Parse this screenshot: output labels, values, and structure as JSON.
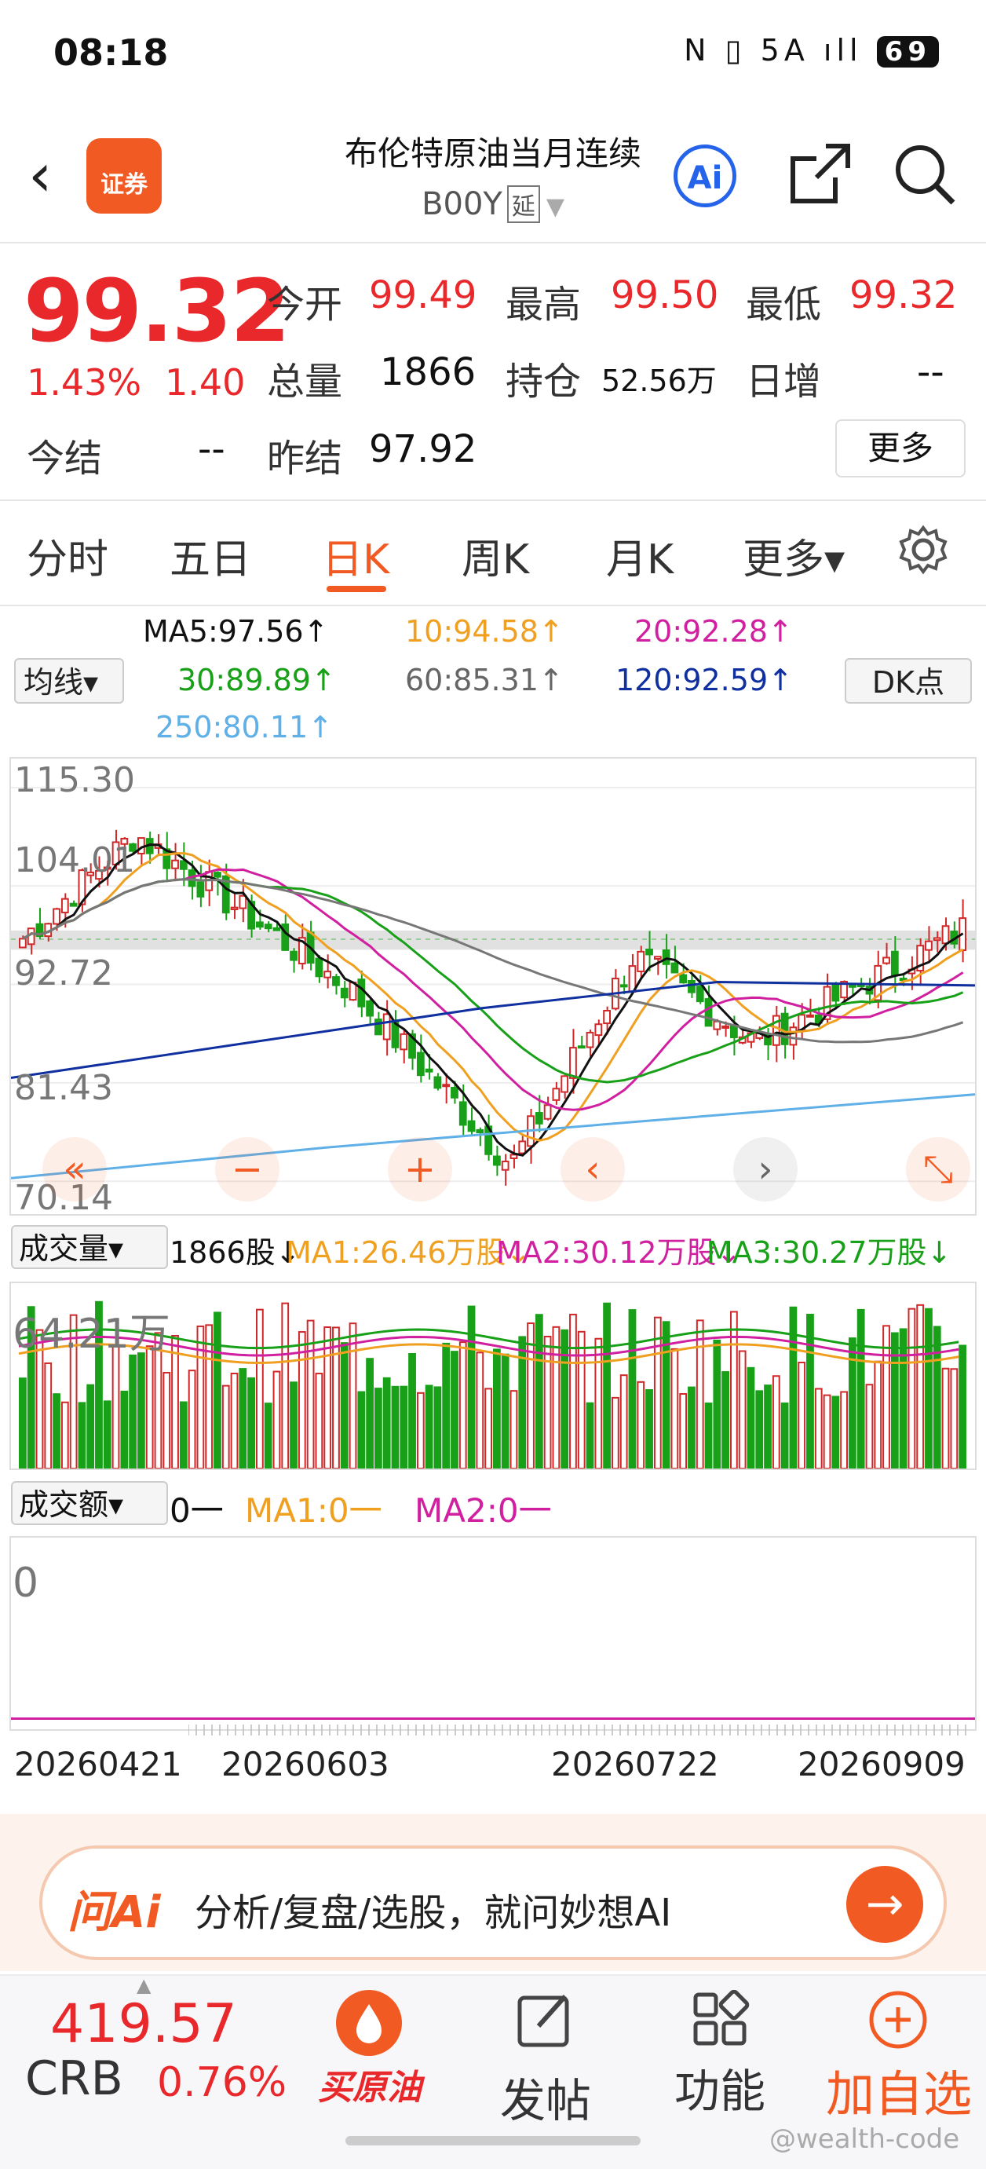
{
  "status_bar": {
    "time": "08:18",
    "icons": "N ▯ 5A ıll",
    "battery": "69"
  },
  "header": {
    "title": "布伦特原油当月连续",
    "code": "B00Y",
    "tag": "延",
    "logo_text": "证券",
    "ai_label": "Ai"
  },
  "quote": {
    "price": "99.32",
    "change_pct": "1.43%",
    "change": "1.40",
    "open_label": "今开",
    "open": "99.49",
    "high_label": "最高",
    "high": "99.50",
    "low_label": "最低",
    "low": "99.32",
    "volume_label": "总量",
    "volume": "1866",
    "oi_label": "持仓",
    "oi": "52.56万",
    "day_inc_label": "日增",
    "day_inc": "--",
    "settle_label": "今结",
    "settle": "--",
    "prev_settle_label": "昨结",
    "prev_settle": "97.92",
    "more_label": "更多"
  },
  "tabs": [
    {
      "label": "分时"
    },
    {
      "label": "五日"
    },
    {
      "label": "日K"
    },
    {
      "label": "周K"
    },
    {
      "label": "月K"
    },
    {
      "label": "更多▾"
    }
  ],
  "ma_bar": {
    "select": "均线▾",
    "dk": "DK点",
    "items": [
      {
        "text": "MA5:97.56↑",
        "color": "#111111"
      },
      {
        "text": "10:94.58↑",
        "color": "#f0a020"
      },
      {
        "text": "20:92.28↑",
        "color": "#d020a0"
      },
      {
        "text": "30:89.89↑",
        "color": "#18a018"
      },
      {
        "text": "60:85.31↑",
        "color": "#666666"
      },
      {
        "text": "120:92.59↑",
        "color": "#1030a0"
      },
      {
        "text": "250:80.11↑",
        "color": "#60b0e8"
      }
    ]
  },
  "price_axis": [
    "115.30",
    "104.01",
    "92.72",
    "81.43",
    "70.14"
  ],
  "nav_buttons": [
    "«",
    "−",
    "+",
    "‹",
    "›",
    "⤡"
  ],
  "volume_bar": {
    "select": "成交量▾",
    "current": "1866股↓",
    "ma1": "MA1:26.46万股↓",
    "ma2": "MA2:30.12万股↓",
    "ma3": "MA3:30.27万股↓",
    "axis_max": "64.21万"
  },
  "amount_bar": {
    "select": "成交额▾",
    "current": "0一",
    "ma1": "MA1:0一",
    "ma2": "MA2:0一",
    "axis": "0"
  },
  "dates": [
    "20260421",
    "20260603",
    "20260722",
    "20260909"
  ],
  "ask": {
    "logo": "问Ai",
    "text": "分析/复盘/选股，就问妙想AI",
    "go": "→"
  },
  "bottom": {
    "crb_price": "419.57",
    "crb_name": "CRB",
    "crb_pct": "0.76%",
    "buy": "买原油",
    "post": "发帖",
    "func": "功能",
    "watch": "加自选"
  },
  "watermark": "@wealth-code",
  "colors": {
    "up": "#e8282b",
    "down": "#1a9b2a",
    "accent": "#f15a22"
  }
}
